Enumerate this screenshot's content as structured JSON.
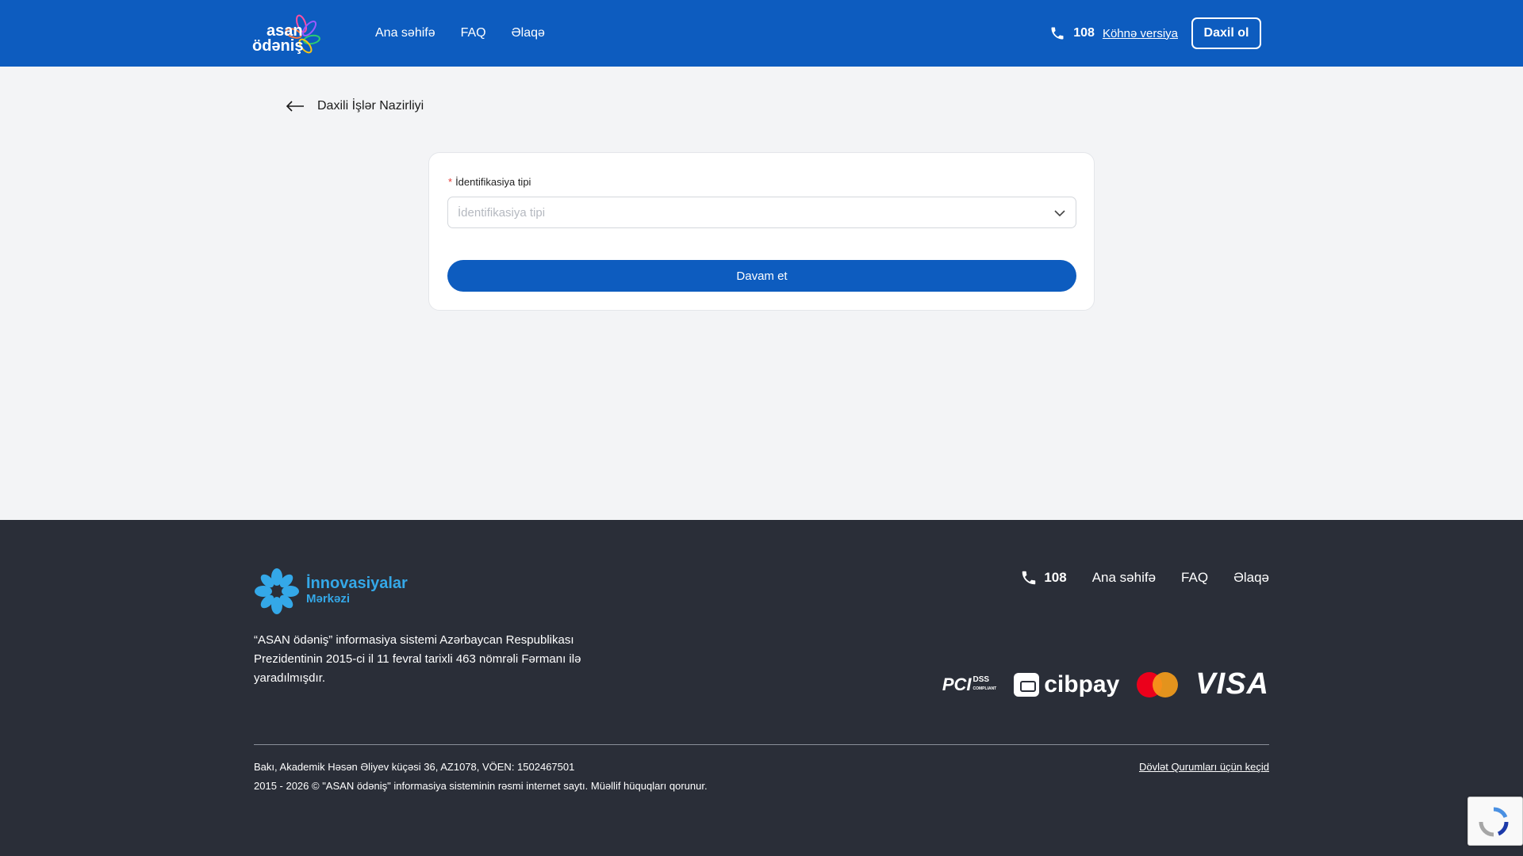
{
  "header": {
    "logo_line1": "asan",
    "logo_line2": "ödəniş",
    "nav": [
      "Ana səhifə",
      "FAQ",
      "Əlaqə"
    ],
    "phone": "108",
    "old_version": "Köhnə versiya",
    "login": "Daxil ol"
  },
  "breadcrumb": {
    "back_label": "Daxili İşlər Nazirliyi"
  },
  "form": {
    "field_label": "İdentifikasiya tipi",
    "required_mark": "*",
    "select_placeholder": "İdentifikasiya tipi",
    "submit_label": "Davam et"
  },
  "footer": {
    "logo_line1": "İnnovasiyalar",
    "logo_line2": "Mərkəzi",
    "description": "“ASAN ödəniş” informasiya sistemi Azərbaycan Respublikası Prezidentinin 2015-ci il 11 fevral tarixli 463 nömrəli Fərmanı ilə yaradılmışdır.",
    "phone": "108",
    "nav": [
      "Ana səhifə",
      "FAQ",
      "Əlaqə"
    ],
    "payments": {
      "pci_main": "PCI",
      "pci_sub": "DSS",
      "pci_note": "COMPLIANT",
      "cibpay": "cibpay",
      "visa": "VISA"
    },
    "address": "Bakı, Akademik Həsən Əliyev küçəsi 36, AZ1078, VÖEN: 1502467501",
    "copyright": "2015 - 2026 © \"ASAN ödəniş\" informasiya sisteminin rəsmi internet saytı. Müəllif hüquqları qorunur.",
    "gov_link": "Dövlət Qurumları üçün keçid"
  },
  "colors": {
    "primary": "#0d5cbf",
    "footer_bg": "#2a2e38",
    "page_bg": "#f3f4f6"
  }
}
